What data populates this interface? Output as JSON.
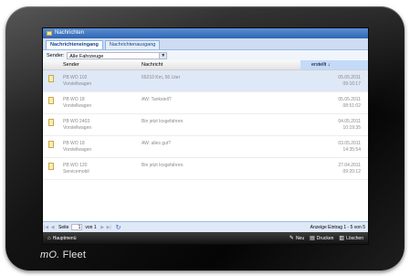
{
  "window": {
    "title": "Nachrichten"
  },
  "tabs": [
    {
      "label": "Nachrichteneingang",
      "active": true
    },
    {
      "label": "Nachrichtenausgang",
      "active": false
    }
  ],
  "filter": {
    "label": "Sender:",
    "value": "Alle Fahrzeuge"
  },
  "columns": [
    "Sender",
    "Nachricht",
    "erstellt ↓"
  ],
  "rows": [
    {
      "sender_line1": "PB WO 102",
      "sender_line2": "Vorstellwagen",
      "message": "65210 Km, 56 Liter",
      "date": "05.05.2011",
      "time": "09:16:17",
      "selected": true
    },
    {
      "sender_line1": "PB WO 18",
      "sender_line2": "Vorstellwagen",
      "message": "AW: Tankstell?",
      "date": "05.05.2011",
      "time": "08:51:02",
      "selected": false
    },
    {
      "sender_line1": "PB WO 2403",
      "sender_line2": "Vorstellwagen",
      "message": "Bin jetzt losgefahren.",
      "date": "04.05.2011",
      "time": "10:19:35",
      "selected": false
    },
    {
      "sender_line1": "PB WO 18",
      "sender_line2": "Vorstellwagen",
      "message": "AW: alles gut?",
      "date": "03.05.2011",
      "time": "14:35:54",
      "selected": false
    },
    {
      "sender_line1": "PB WO 120",
      "sender_line2": "Servicemobil",
      "message": "Bin jetzt losgefahren.",
      "date": "27.04.2011",
      "time": "09:20:12",
      "selected": false
    }
  ],
  "pager": {
    "first": "|◀",
    "prev": "◀",
    "page_label": "Seite",
    "page_value": "1",
    "of_label": "von 1",
    "next": "▶",
    "last": "▶|",
    "refresh": "↻",
    "display": "Anzeige Eintrag 1 - 5 von 5"
  },
  "bottombar": {
    "home": "Hauptmenü",
    "new": "Neu",
    "print": "Drucken",
    "delete": "Löschen"
  },
  "brand": {
    "mo": "mO.",
    "fleet": "Fleet"
  }
}
